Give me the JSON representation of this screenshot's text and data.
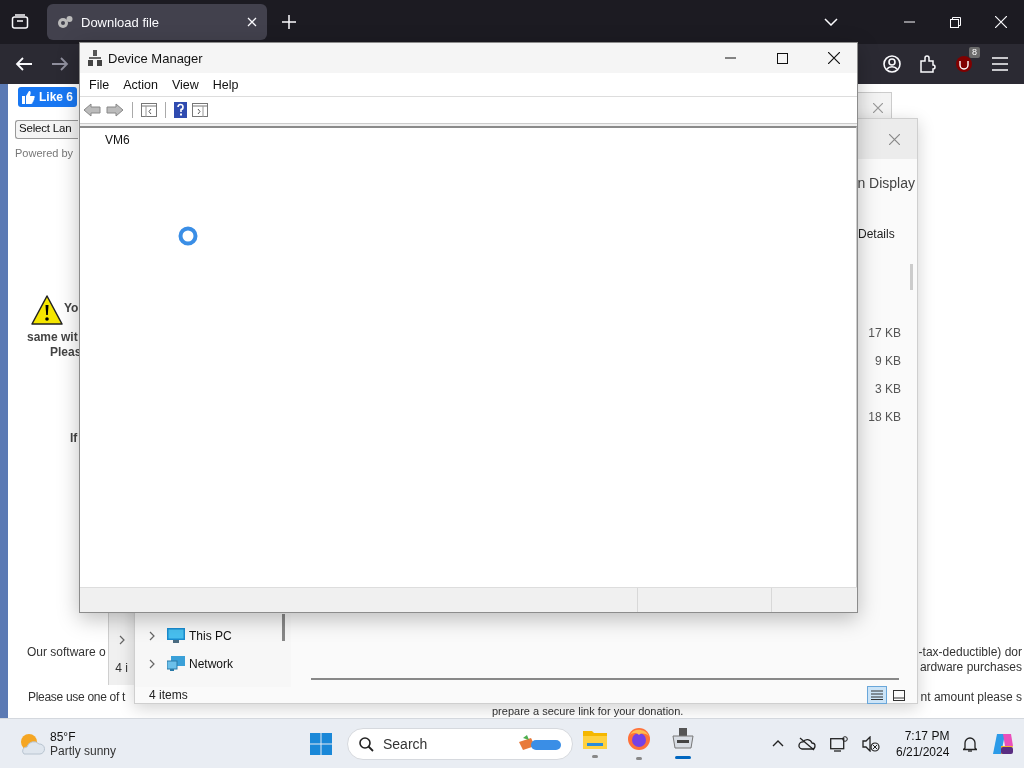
{
  "browser": {
    "tabs": [
      {
        "title": "Download file",
        "selected": true
      }
    ],
    "extension_badge": "8",
    "page": {
      "like_button": "Like 6",
      "language_select": "Select Lan",
      "powered_by": "Powered by",
      "warning_lines": [
        "Yo",
        "same wit",
        "Pleas"
      ],
      "note_line": "If",
      "left_texts": [
        "Our software o",
        "Please use one of t"
      ],
      "right_texts": [
        "-tax-deductible) dor",
        "ardware purchases",
        "nt amount please s"
      ],
      "bottom_text": "prepare a secure link for your donation."
    }
  },
  "explorer": {
    "header": "n Display",
    "column": "Details",
    "sizes": [
      "17 KB",
      "9 KB",
      "3 KB",
      "18 KB"
    ],
    "left_peek": "4 i",
    "nav": [
      {
        "label": "This PC",
        "kind": "pc"
      },
      {
        "label": "Network",
        "kind": "network"
      }
    ],
    "status": "4 items",
    "views": [
      {
        "kind": "details",
        "selected": true
      },
      {
        "kind": "tiles",
        "selected": false
      }
    ]
  },
  "device_manager": {
    "title": "Device Manager",
    "menu": [
      "File",
      "Action",
      "View",
      "Help"
    ],
    "tree_root": "VM6"
  },
  "taskbar": {
    "weather": {
      "temp": "85°F",
      "desc": "Partly sunny"
    },
    "search": {
      "placeholder": "Search"
    },
    "apps": [
      {
        "kind": "files",
        "selected": false
      },
      {
        "kind": "firefox",
        "selected": false
      },
      {
        "kind": "devmgr",
        "selected": true
      }
    ],
    "time": "7:17 PM",
    "date": "6/21/2024"
  }
}
